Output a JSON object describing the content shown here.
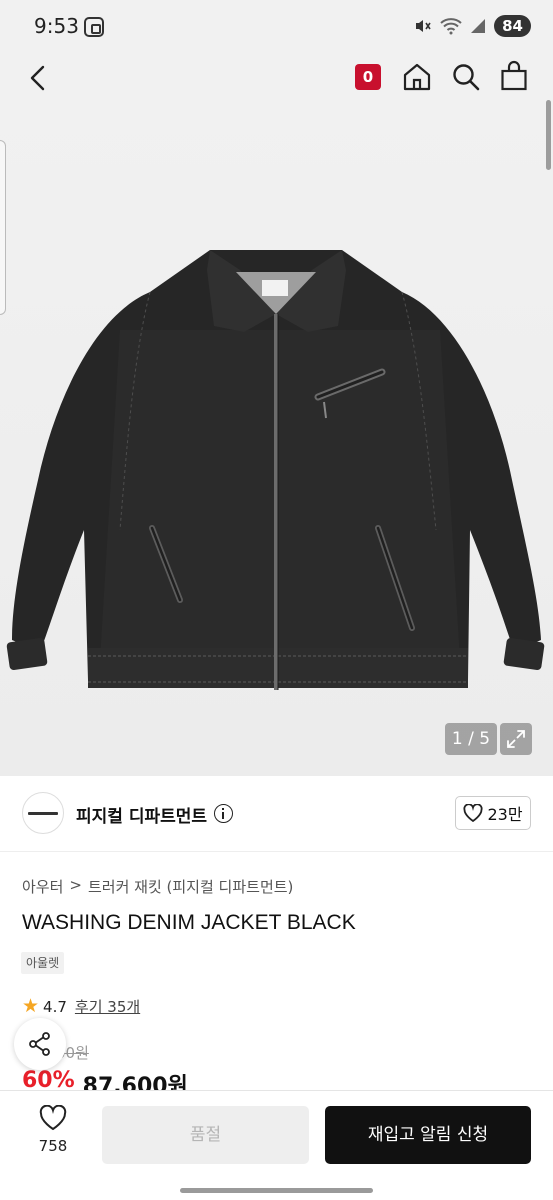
{
  "status_bar": {
    "time": "9:53",
    "battery": "84"
  },
  "header": {
    "cart_count": "0"
  },
  "gallery": {
    "counter": "1 / 5"
  },
  "brand": {
    "name": "피지컬 디파트먼트",
    "likes": "23만"
  },
  "product": {
    "breadcrumb": [
      "아우터",
      ">",
      "트러커 재킷 (피지컬 디파트먼트)"
    ],
    "title": "WASHING DENIM JACKET BLACK",
    "badge": "아울렛",
    "rating": "4.7",
    "reviews": "후기 35개",
    "original_price": "00원",
    "discount": "60%",
    "sale_price": "87,600원"
  },
  "bottom_bar": {
    "wishlist_count": "758",
    "option_label": "품절",
    "restock_label": "재입고 알림 신청"
  },
  "colors": {
    "accent_red": "#e8202a",
    "badge_red": "#c8102e",
    "primary_black": "#111111"
  }
}
